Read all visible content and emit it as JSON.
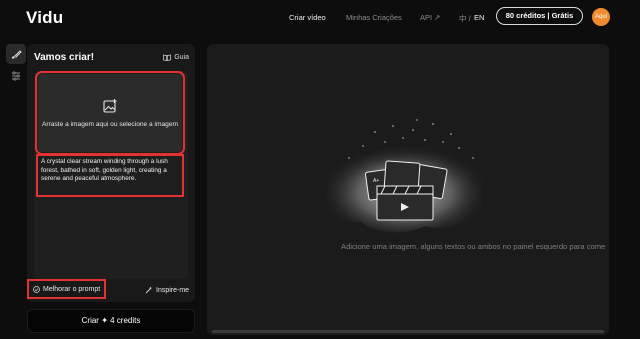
{
  "header": {
    "logo": "Vidu",
    "nav": {
      "create_video": "Criar vídeo",
      "my_creations": "Minhas Criações",
      "api": "API ↗",
      "lang_zh": "中 /",
      "lang_en": "EN"
    },
    "credits_button": "80 créditos | Grátis",
    "avatar_label": "Aqui"
  },
  "left_panel": {
    "title": "Vamos criar!",
    "guide_label": "Guia",
    "upload_text": "Arraste a imagem aqui ou selecione a imagem",
    "prompt_text": "A crystal clear stream winding through a lush forest, bathed in soft, golden light, creating a serene and peaceful atmosphere.",
    "enhance_label": "Melhorar o prompt",
    "inspire_label": "Inspire-me",
    "create_label": "Criar ✦ 4 credits"
  },
  "canvas": {
    "hint": "Adicione uma imagem, alguns textos ou ambos no painel esquerdo para come"
  },
  "colors": {
    "accent_orange": "#f08a2e",
    "highlight_red": "#e23232",
    "panel_bg": "#191919"
  }
}
